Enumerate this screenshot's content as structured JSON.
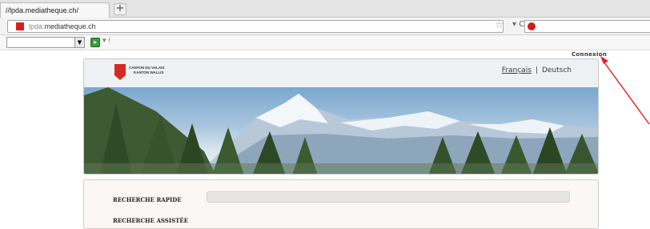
{
  "browser": {
    "tab_title": "//lpda.mediatheque.ch/",
    "new_tab_label": "+",
    "url_prefix": "lpda.",
    "url_main": "mediatheque.ch"
  },
  "page": {
    "connexion_link": "Connexion",
    "banner": {
      "logo_line1": "CANTON DU VALAIS",
      "logo_line2": "KANTON WALLIS",
      "lang_fr": "Français",
      "lang_sep": "|",
      "lang_de": "Deutsch"
    },
    "search": {
      "rapide_label": "RECHERCHE RAPIDE",
      "assistee_label": "RECHERCHE ASSISTÉE"
    }
  },
  "colors": {
    "annotation_arrow": "#ee1c1c",
    "valais_red": "#d32b22"
  }
}
